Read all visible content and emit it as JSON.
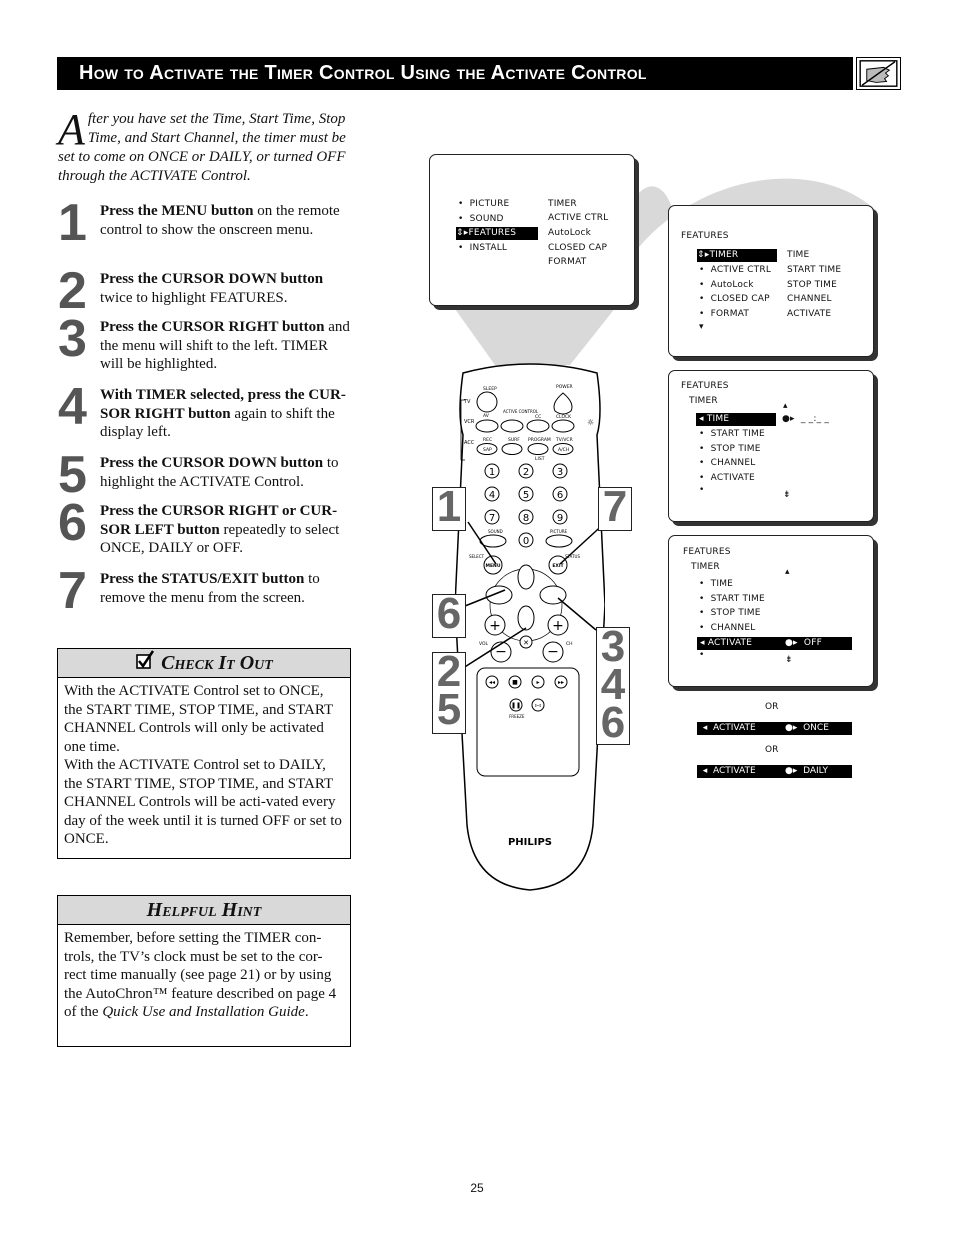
{
  "header": {
    "title": "How to Activate the Timer Control Using the Activate Control",
    "icon": "hand-pointer-icon"
  },
  "intro": {
    "dropcap": "A",
    "text": "fter you have set the Time, Start Time, Stop Time, and Start Channel, the timer must be set to come on ONCE or DAILY,  or turned OFF through the ACTIVATE Control."
  },
  "steps": [
    {
      "num": "1",
      "bold": "Press the MENU button",
      "rest": " on the remote control to show the onscreen menu."
    },
    {
      "num": "2",
      "bold": "Press the CURSOR DOWN button",
      "rest": " twice to highlight FEATURES."
    },
    {
      "num": "3",
      "bold": "Press the CURSOR RIGHT button",
      "rest": " and the menu will shift to the left. TIMER will be highlighted."
    },
    {
      "num": "4",
      "bold": "With TIMER selected, press the CUR-SOR RIGHT button",
      "rest": " again to shift the display left."
    },
    {
      "num": "5",
      "bold": "Press the CURSOR DOWN button",
      "rest": " to highlight the ACTIVATE Control."
    },
    {
      "num": "6",
      "bold": "Press the CURSOR RIGHT or CUR-SOR LEFT button",
      "rest": " repeatedly to select ONCE, DAILY or OFF."
    },
    {
      "num": "7",
      "bold": "Press the STATUS/EXIT button",
      "rest": " to remove the menu from the screen."
    }
  ],
  "check_it_out": {
    "icon": "checkbox-icon",
    "title": "Check It Out",
    "paragraphs": [
      "With the ACTIVATE Control set to ONCE, the START TIME, STOP TIME, and START CHANNEL Controls will only be activated one time.",
      "With the ACTIVATE Control set to DAILY, the START TIME, STOP TIME, and START CHANNEL Controls will be acti-vated every day of the week until it is turned OFF or set to ONCE."
    ]
  },
  "helpful_hint": {
    "title": "Helpful Hint",
    "text_before": "Remember, before setting the TIMER con-trols, the TV’s clock must be set to the cor-rect time manually (see page 21) or by using the AutoChron™ feature described on page 4 of the ",
    "text_italic": "Quick Use and Installation Guide",
    "text_after": "."
  },
  "screen1": {
    "left_items": [
      "PICTURE",
      "SOUND",
      "FEATURES",
      "INSTALL"
    ],
    "selected": "FEATURES",
    "right_items": [
      "TIMER",
      "ACTIVE  CTRL",
      "AutoLock",
      "CLOSED  CAP",
      "FORMAT"
    ]
  },
  "screen2": {
    "heading": "FEATURES",
    "left_items": [
      "TIMER",
      "ACTIVE  CTRL",
      "AutoLock",
      "CLOSED  CAP",
      "FORMAT"
    ],
    "selected": "TIMER",
    "right_items": [
      "TIME",
      "START  TIME",
      "STOP  TIME",
      "CHANNEL",
      "ACTIVATE"
    ]
  },
  "screen3": {
    "heading": "FEATURES",
    "subheading": "TIMER",
    "items": [
      "TIME",
      "START  TIME",
      "STOP  TIME",
      "CHANNEL",
      "ACTIVATE"
    ],
    "selected": "TIME",
    "value": "_ _:_ _"
  },
  "screen4": {
    "heading": "FEATURES",
    "subheading": "TIMER",
    "items": [
      "TIME",
      "START  TIME",
      "STOP  TIME",
      "CHANNEL",
      "ACTIVATE"
    ],
    "selected": "ACTIVATE",
    "value": "OFF"
  },
  "alternatives": [
    {
      "or": "OR",
      "label": "ACTIVATE",
      "value": "ONCE"
    },
    {
      "or": "OR",
      "label": "ACTIVATE",
      "value": "DAILY"
    }
  ],
  "remote": {
    "brand": "PHILIPS",
    "labels": {
      "sleep": "SLEEP",
      "power": "POWER",
      "tv": "TV",
      "vcr": "VCR",
      "acc": "ACC",
      "av": "AV",
      "active_control": "ACTIVE CONTROL",
      "cc": "CC",
      "clock": "CLOCK",
      "rec": "REC",
      "sap": "SAP",
      "surf": "SURF",
      "program_list": "PROGRAM",
      "list": "LIST",
      "tv_vcr": "TV/VCR",
      "ach": "A/CH",
      "sound": "SOUND",
      "picture": "PICTURE",
      "select": "SELECT",
      "menu": "MENU",
      "exit": "EXIT",
      "status": "STATUS",
      "vol": "VOL",
      "ch": "CH",
      "freeze": "FREEZE"
    },
    "digits": [
      "1",
      "2",
      "3",
      "4",
      "5",
      "6",
      "7",
      "8",
      "9",
      "0"
    ],
    "callouts": {
      "menu": "1",
      "exit": "7",
      "left": "6",
      "down": "2\n5",
      "right": "3\n4\n6"
    }
  },
  "page_number": "25"
}
